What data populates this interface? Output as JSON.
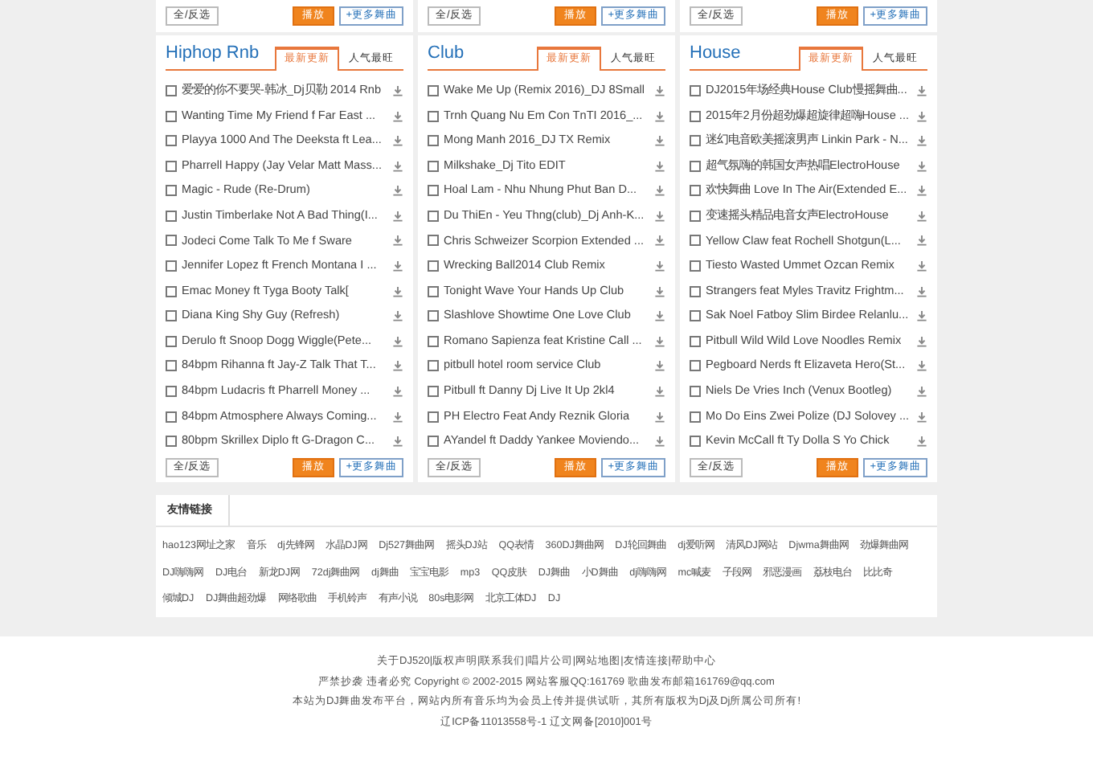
{
  "top_strip": [
    {
      "buttons": [
        "全/反选",
        "播放",
        "+更多舞曲"
      ]
    },
    {
      "buttons": [
        "全/反选",
        "播放",
        "+更多舞曲"
      ]
    },
    {
      "buttons": [
        "全/反选",
        "播放",
        "+更多舞曲"
      ]
    }
  ],
  "panels": [
    {
      "title": "Hiphop Rnb",
      "tabs": [
        {
          "label": "最新更新",
          "selected": true
        },
        {
          "label": "人气最旺",
          "selected": false
        }
      ],
      "songs": [
        {
          "title": "爱爱的你不要哭-韩冰_Dj贝勒 2014 Rnb",
          "checked": false
        },
        {
          "title": "Wanting Time My Friend f Far East ...",
          "checked": false
        },
        {
          "title": "Playya 1000 And The Deeksta ft Lea...",
          "checked": false
        },
        {
          "title": "Pharrell Happy (Jay Velar Matt Mass...",
          "checked": false
        },
        {
          "title": "Magic - Rude (Re-Drum)",
          "checked": false
        },
        {
          "title": "Justin Timberlake Not A Bad Thing(I...",
          "checked": false
        },
        {
          "title": "Jodeci Come Talk To Me f Sware",
          "checked": false
        },
        {
          "title": "Jennifer Lopez ft French Montana I ...",
          "checked": false
        },
        {
          "title": "Emac Money ft Tyga Booty Talk[",
          "checked": false
        },
        {
          "title": "Diana King Shy Guy (Refresh)",
          "checked": false
        },
        {
          "title": "Derulo ft Snoop Dogg Wiggle(Pete...",
          "checked": false
        },
        {
          "title": "84bpm Rihanna ft Jay-Z Talk That T...",
          "checked": false
        },
        {
          "title": "84bpm Ludacris ft Pharrell Money ...",
          "checked": false
        },
        {
          "title": "84bpm Atmosphere Always Coming...",
          "checked": false
        },
        {
          "title": "80bpm Skrillex Diplo ft G-Dragon C...",
          "checked": false
        }
      ],
      "buttons": [
        "全/反选",
        "播放",
        "+更多舞曲"
      ]
    },
    {
      "title": "Club",
      "tabs": [
        {
          "label": "最新更新",
          "selected": true
        },
        {
          "label": "人气最旺",
          "selected": false
        }
      ],
      "songs": [
        {
          "title": "Wake Me Up (Remix 2016)_DJ 8Small",
          "checked": false
        },
        {
          "title": "Trnh Quang Nu Em Con TnTI 2016_...",
          "checked": false
        },
        {
          "title": "Mong Manh 2016_DJ TX Remix",
          "checked": false
        },
        {
          "title": "Milkshake_Dj Tito EDIT",
          "checked": false
        },
        {
          "title": "Hoal Lam - Nhu Nhung Phut Ban D...",
          "checked": false
        },
        {
          "title": "Du ThiEn - Yeu Thng(club)_Dj Anh-K...",
          "checked": false
        },
        {
          "title": "Chris Schweizer Scorpion Extended ...",
          "checked": false
        },
        {
          "title": "Wrecking Ball2014 Club Remix",
          "checked": false
        },
        {
          "title": "Tonight Wave Your Hands Up Club",
          "checked": false
        },
        {
          "title": "Slashlove Showtime One Love Club",
          "checked": false
        },
        {
          "title": "Romano Sapienza feat Kristine Call ...",
          "checked": false
        },
        {
          "title": "pitbull hotel room service Club",
          "checked": false
        },
        {
          "title": "Pitbull ft Danny Dj Live It Up 2kl4",
          "checked": false
        },
        {
          "title": "PH Electro Feat Andy Reznik Gloria",
          "checked": false
        },
        {
          "title": "AYandel ft Daddy Yankee Moviendo...",
          "checked": false
        }
      ],
      "buttons": [
        "全/反选",
        "播放",
        "+更多舞曲"
      ]
    },
    {
      "title": "House",
      "tabs": [
        {
          "label": "最新更新",
          "selected": true
        },
        {
          "label": "人气最旺",
          "selected": false
        }
      ],
      "songs": [
        {
          "title": "DJ2015年场经典House Club慢摇舞曲...",
          "checked": false
        },
        {
          "title": "2015年2月份超劲爆超旋律超嗨House ...",
          "checked": false
        },
        {
          "title": "迷幻电音欧美摇滚男声 Linkin Park - N...",
          "checked": false
        },
        {
          "title": "超气氛嗨的韩国女声热唱ElectroHouse",
          "checked": false
        },
        {
          "title": "欢快舞曲 Love In The Air(Extended E...",
          "checked": false
        },
        {
          "title": "变速摇头精品电音女声ElectroHouse",
          "checked": false
        },
        {
          "title": "Yellow Claw feat Rochell Shotgun(L...",
          "checked": false
        },
        {
          "title": "Tiesto Wasted Ummet Ozcan Remix",
          "checked": false
        },
        {
          "title": "Strangers feat Myles Travitz Frightm...",
          "checked": false
        },
        {
          "title": "Sak Noel Fatboy Slim Birdee Relanlu...",
          "checked": false
        },
        {
          "title": "Pitbull Wild Wild Love Noodles Remix",
          "checked": false
        },
        {
          "title": "Pegboard Nerds ft Elizaveta Hero(St...",
          "checked": false
        },
        {
          "title": "Niels De Vries Inch (Venux Bootleg)",
          "checked": false
        },
        {
          "title": "Mo Do Eins Zwei Polize (DJ Solovey ...",
          "checked": false
        },
        {
          "title": "Kevin McCall ft Ty Dolla S Yo Chick",
          "checked": false
        }
      ],
      "buttons": [
        "全/反选",
        "播放",
        "+更多舞曲"
      ]
    }
  ],
  "friend_links": {
    "title": "友情链接",
    "links": [
      "hao123网址之家",
      "音乐",
      "dj先锋网",
      "水晶DJ网",
      "Dj527舞曲网",
      "摇头DJ站",
      "QQ表情",
      "360DJ舞曲网",
      "DJ轮回舞曲",
      "dj爱听网",
      "清风DJ网站",
      "Djwma舞曲网",
      "劲爆舞曲网",
      "DJ嗨嗨网",
      "DJ电台",
      "新龙DJ网",
      "72dj舞曲网",
      "dj舞曲",
      "宝宝电影",
      "mp3",
      "QQ皮肤",
      "DJ舞曲",
      "小D舞曲",
      "dj嗨嗨网",
      "mc喊麦",
      "子段网",
      "邪恶漫画",
      "荔枝电台",
      "比比奇",
      "倾城DJ",
      "DJ舞曲超劲爆",
      "网络歌曲",
      "手机铃声",
      "有声小说",
      "80s电影网",
      "北京工体DJ",
      "DJ"
    ]
  },
  "footer": [
    "关于DJ520|版权声明|联系我们|唱片公司|网站地图|友情连接|帮助中心",
    "严禁抄袭 违者必究 Copyright © 2002-2015 网站客服QQ:161769 歌曲发布邮箱161769@qq.com",
    "本站为DJ舞曲发布平台，网站内所有音乐均为会员上传并提供试听，其所有版权为Dj及Dj所属公司所有!",
    "辽ICP备11013558号-1 辽文网备[2010]001号"
  ]
}
